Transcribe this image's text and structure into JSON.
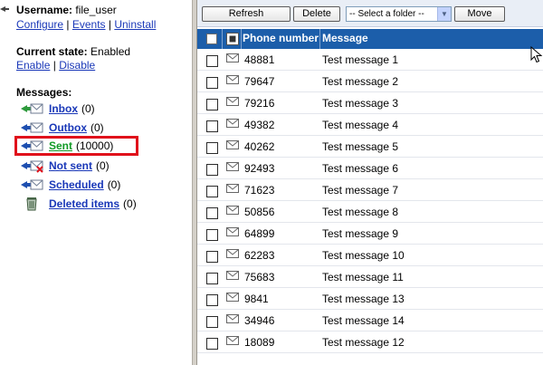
{
  "user": {
    "username_label": "Username:",
    "username_value": "file_user",
    "links": [
      "Configure",
      "Events",
      "Uninstall"
    ],
    "sep": "|"
  },
  "state": {
    "label": "Current state:",
    "value": "Enabled",
    "links": [
      "Enable",
      "Disable"
    ]
  },
  "messages_title": "Messages:",
  "folders": [
    {
      "name": "Inbox",
      "count": "(0)",
      "icon": "inbox-icon"
    },
    {
      "name": "Outbox",
      "count": "(0)",
      "icon": "outbox-icon"
    },
    {
      "name": "Sent",
      "count": "(10000)",
      "icon": "sent-icon"
    },
    {
      "name": "Not sent",
      "count": "(0)",
      "icon": "not-sent-icon"
    },
    {
      "name": "Scheduled",
      "count": "(0)",
      "icon": "scheduled-icon"
    },
    {
      "name": "Deleted items",
      "count": "(0)",
      "icon": "trash-icon"
    }
  ],
  "toolbar": {
    "refresh_label": "Refresh",
    "delete_label": "Delete",
    "folder_select": "-- Select a folder --",
    "move_label": "Move"
  },
  "table": {
    "col_phone": "Phone number",
    "col_message": "Message",
    "rows": [
      {
        "phone": "48881",
        "message": "Test message 1"
      },
      {
        "phone": "79647",
        "message": "Test message 2"
      },
      {
        "phone": "79216",
        "message": "Test message 3"
      },
      {
        "phone": "49382",
        "message": "Test message 4"
      },
      {
        "phone": "40262",
        "message": "Test message 5"
      },
      {
        "phone": "92493",
        "message": "Test message 6"
      },
      {
        "phone": "71623",
        "message": "Test message 7"
      },
      {
        "phone": "50856",
        "message": "Test message 8"
      },
      {
        "phone": "64899",
        "message": "Test message 9"
      },
      {
        "phone": "62283",
        "message": "Test message 10"
      },
      {
        "phone": "75683",
        "message": "Test message 11"
      },
      {
        "phone": "9841",
        "message": "Test message 13"
      },
      {
        "phone": "34946",
        "message": "Test message 14"
      },
      {
        "phone": "18089",
        "message": "Test message 12"
      }
    ]
  },
  "colors": {
    "header_bg": "#1c5eaa",
    "link": "#1a38b8",
    "sent_link": "#119a26",
    "highlight": "#e0111b"
  }
}
